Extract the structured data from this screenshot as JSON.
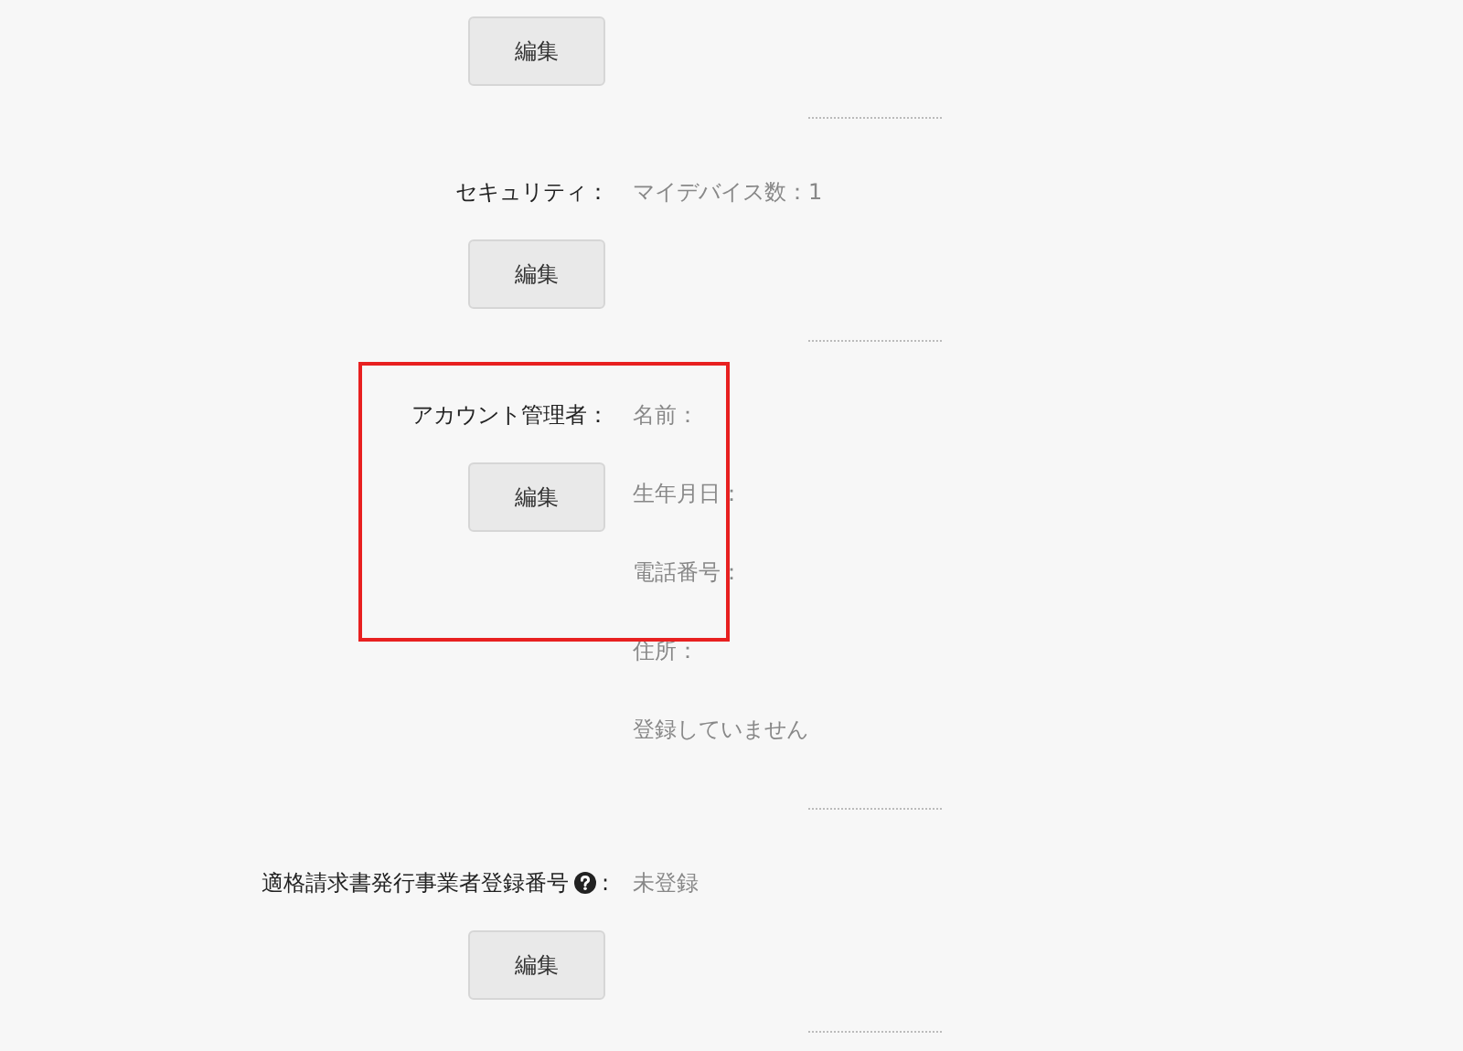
{
  "sections": [
    {
      "button": "編集",
      "help": false,
      "highlighted": false
    },
    {
      "label": "セキュリティ：",
      "help": false,
      "highlighted": false,
      "values": [
        "マイデバイス数：1"
      ],
      "button": "編集"
    },
    {
      "label": "アカウント管理者：",
      "help": false,
      "highlighted": true,
      "values": [
        "名前：",
        "生年月日：",
        "電話番号：",
        "住所：",
        "登録していません"
      ],
      "button": "編集"
    },
    {
      "label": "適格請求書発行事業者登録番号",
      "help": true,
      "colon": ":",
      "highlighted": false,
      "values": [
        "未登録"
      ],
      "button": "編集"
    }
  ]
}
